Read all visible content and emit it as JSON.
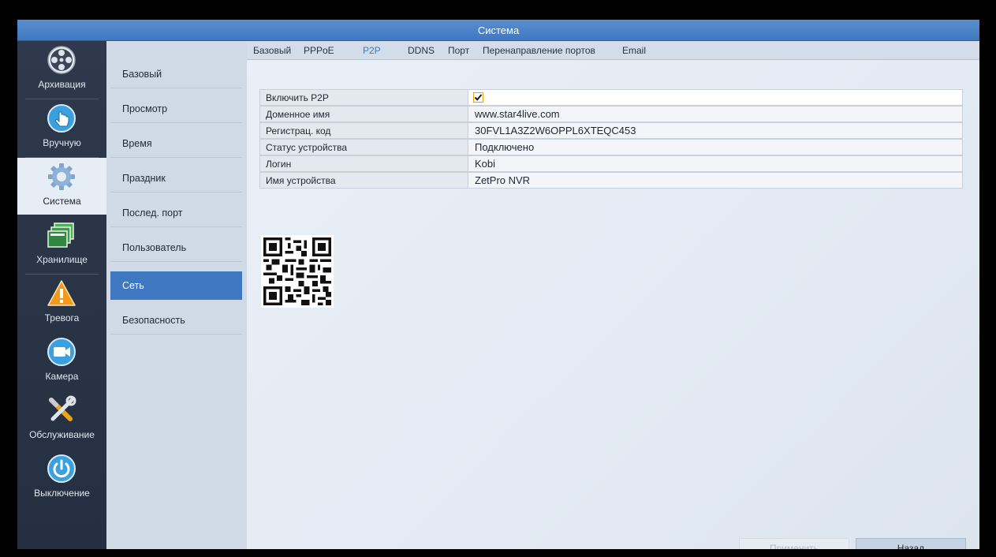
{
  "window": {
    "title": "Система"
  },
  "nav": {
    "items": [
      {
        "label": "Архивация",
        "icon": "film-reel-icon"
      },
      {
        "label": "Вручную",
        "icon": "hand-pointer-icon"
      },
      {
        "label": "Система",
        "icon": "gear-icon",
        "active": true
      },
      {
        "label": "Хранилище",
        "icon": "storage-icon"
      },
      {
        "label": "Тревога",
        "icon": "alarm-warning-icon"
      },
      {
        "label": "Камера",
        "icon": "camera-icon"
      },
      {
        "label": "Обслуживание",
        "icon": "tools-icon"
      },
      {
        "label": "Выключение",
        "icon": "power-icon"
      }
    ]
  },
  "submenu": {
    "items": [
      {
        "label": "Базовый"
      },
      {
        "label": "Просмотр"
      },
      {
        "label": "Время"
      },
      {
        "label": "Праздник"
      },
      {
        "label": "Послед. порт"
      },
      {
        "label": "Пользователь"
      },
      {
        "label": "Сеть",
        "active": true
      },
      {
        "label": "Безопасность"
      }
    ]
  },
  "tabs": [
    {
      "label": "Базовый"
    },
    {
      "label": "PPPoE"
    },
    {
      "label": "P2P",
      "active": true
    },
    {
      "label": "DDNS"
    },
    {
      "label": "Порт"
    },
    {
      "label": "Перенаправление портов"
    },
    {
      "label": "Email"
    }
  ],
  "p2p": {
    "rows": [
      {
        "label": "Включить P2P",
        "checked": true
      },
      {
        "label": "Доменное имя",
        "value": "www.star4live.com"
      },
      {
        "label": "Регистрац. код",
        "value": "30FVL1A3Z2W6OPPL6XTEQC453"
      },
      {
        "label": "Статус устройства",
        "value": "Подключено"
      },
      {
        "label": "Логин",
        "value": "Kobi"
      },
      {
        "label": "Имя устройства",
        "value": "ZetPro NVR"
      }
    ]
  },
  "buttons": {
    "apply": "Применить",
    "back": "Назад"
  },
  "colors": {
    "accent": "#3f78c0",
    "checkbox_border": "#e5a400",
    "nav_bg": "#2e3a4c"
  }
}
